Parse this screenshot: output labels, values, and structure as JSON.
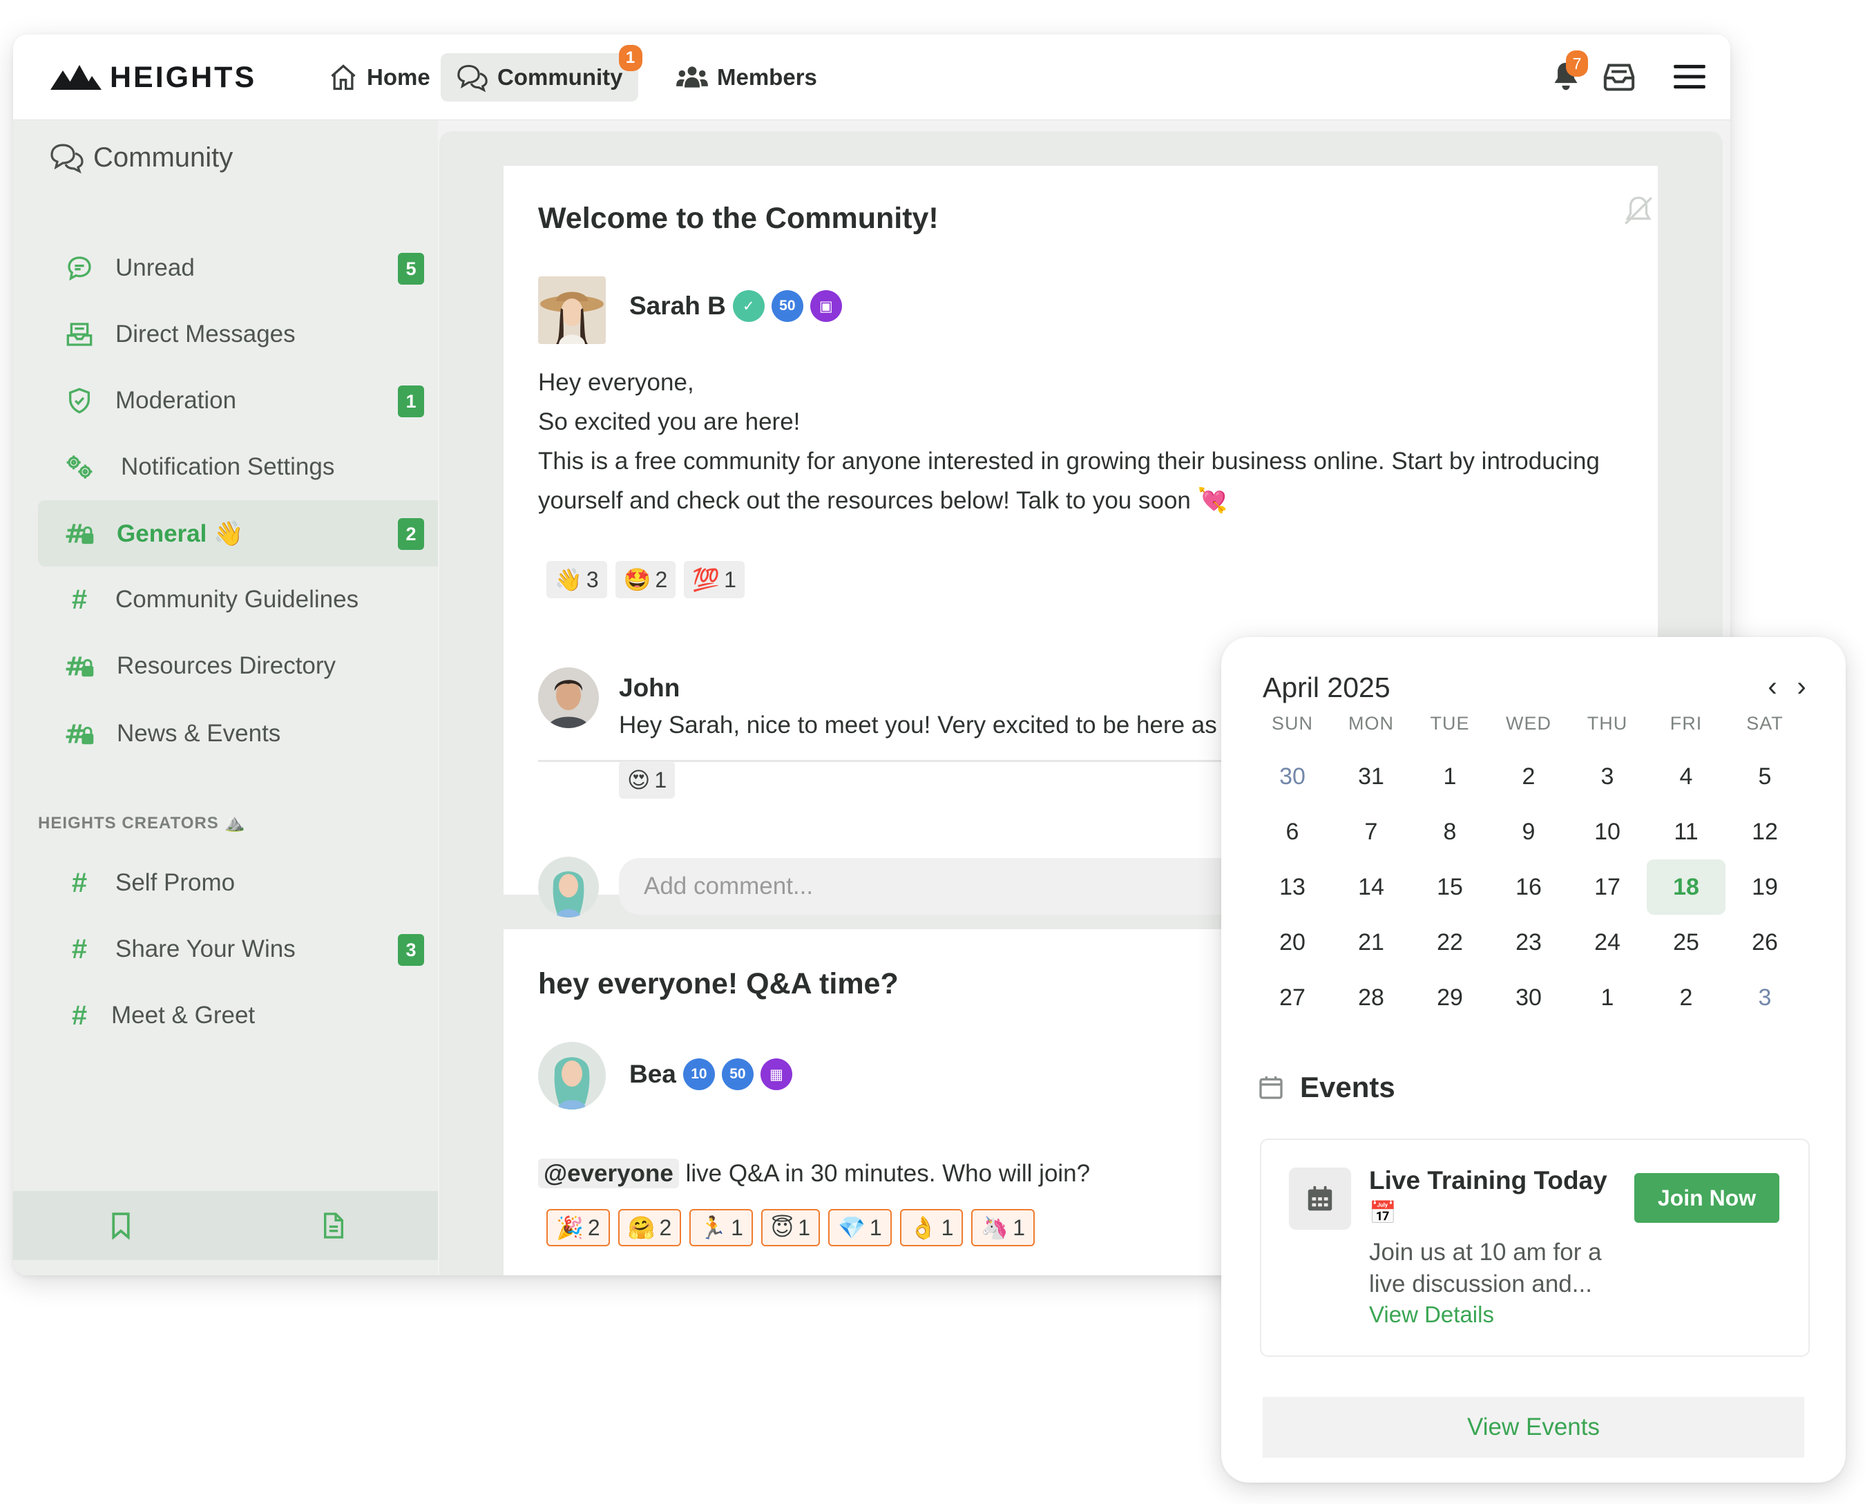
{
  "brand": {
    "name": "HEIGHTS"
  },
  "nav": {
    "home": "Home",
    "community": "Community",
    "community_badge": "1",
    "members": "Members",
    "notifications_badge": "7"
  },
  "sidebar": {
    "title": "Community",
    "items": [
      {
        "label": "Unread",
        "count": "5"
      },
      {
        "label": "Direct Messages"
      },
      {
        "label": "Moderation",
        "count": "1"
      },
      {
        "label": "Notification Settings"
      },
      {
        "label": "General 👋",
        "count": "2"
      },
      {
        "label": "Community Guidelines"
      },
      {
        "label": "Resources Directory"
      },
      {
        "label": "News & Events"
      }
    ],
    "section": "HEIGHTS CREATORS ⛰️",
    "section_items": [
      {
        "label": "Self Promo"
      },
      {
        "label": "Share Your Wins",
        "count": "3"
      },
      {
        "label": "Meet & Greet"
      }
    ]
  },
  "posts": [
    {
      "title": "Welcome to the Community!",
      "author": "Sarah B",
      "badges": [
        "50"
      ],
      "body": [
        "Hey everyone,",
        "So excited you are here!",
        "This is a free community for anyone interested in growing their business online. Start by introducing",
        "yourself and check out the resources below! Talk to you soon 💘"
      ],
      "reactions": [
        {
          "emoji": "👋",
          "count": "3"
        },
        {
          "emoji": "🤩",
          "count": "2"
        },
        {
          "emoji": "💯",
          "count": "1"
        }
      ],
      "comment": {
        "author": "John",
        "text": "Hey Sarah, nice to meet you! Very excited to be here as wel",
        "reaction": {
          "emoji": "😍",
          "count": "1"
        }
      },
      "comment_placeholder": "Add comment..."
    },
    {
      "title": "hey everyone! Q&A time?",
      "author": "Bea",
      "badges": [
        "10",
        "50"
      ],
      "mention": "@everyone",
      "body": "live Q&A in 30 minutes. Who will join?",
      "reactions": [
        {
          "emoji": "🎉",
          "count": "2"
        },
        {
          "emoji": "🤗",
          "count": "2"
        },
        {
          "emoji": "🏃",
          "count": "1"
        },
        {
          "emoji": "😇",
          "count": "1"
        },
        {
          "emoji": "💎",
          "count": "1"
        },
        {
          "emoji": "👌",
          "count": "1"
        },
        {
          "emoji": "🦄",
          "count": "1"
        }
      ]
    }
  ],
  "calendar": {
    "month": "April 2025",
    "weekdays": [
      "SUN",
      "MON",
      "TUE",
      "WED",
      "THU",
      "FRI",
      "SAT"
    ],
    "weeks": [
      [
        "30",
        "31",
        "1",
        "2",
        "3",
        "4",
        "5"
      ],
      [
        "6",
        "7",
        "8",
        "9",
        "10",
        "11",
        "12"
      ],
      [
        "13",
        "14",
        "15",
        "16",
        "17",
        "18",
        "19"
      ],
      [
        "20",
        "21",
        "22",
        "23",
        "24",
        "25",
        "26"
      ],
      [
        "27",
        "28",
        "29",
        "30",
        "1",
        "2",
        "3"
      ]
    ],
    "today": "18",
    "events_heading": "Events",
    "event": {
      "title": "Live Training Today",
      "emoji": "📅",
      "description": "Join us at 10 am for a live discussion and...",
      "link": "View Details",
      "button": "Join Now"
    },
    "view_all": "View Events"
  },
  "colors": {
    "accent": "#3aa553",
    "badge": "#f07c2e",
    "sidebar": "#eceeec"
  }
}
